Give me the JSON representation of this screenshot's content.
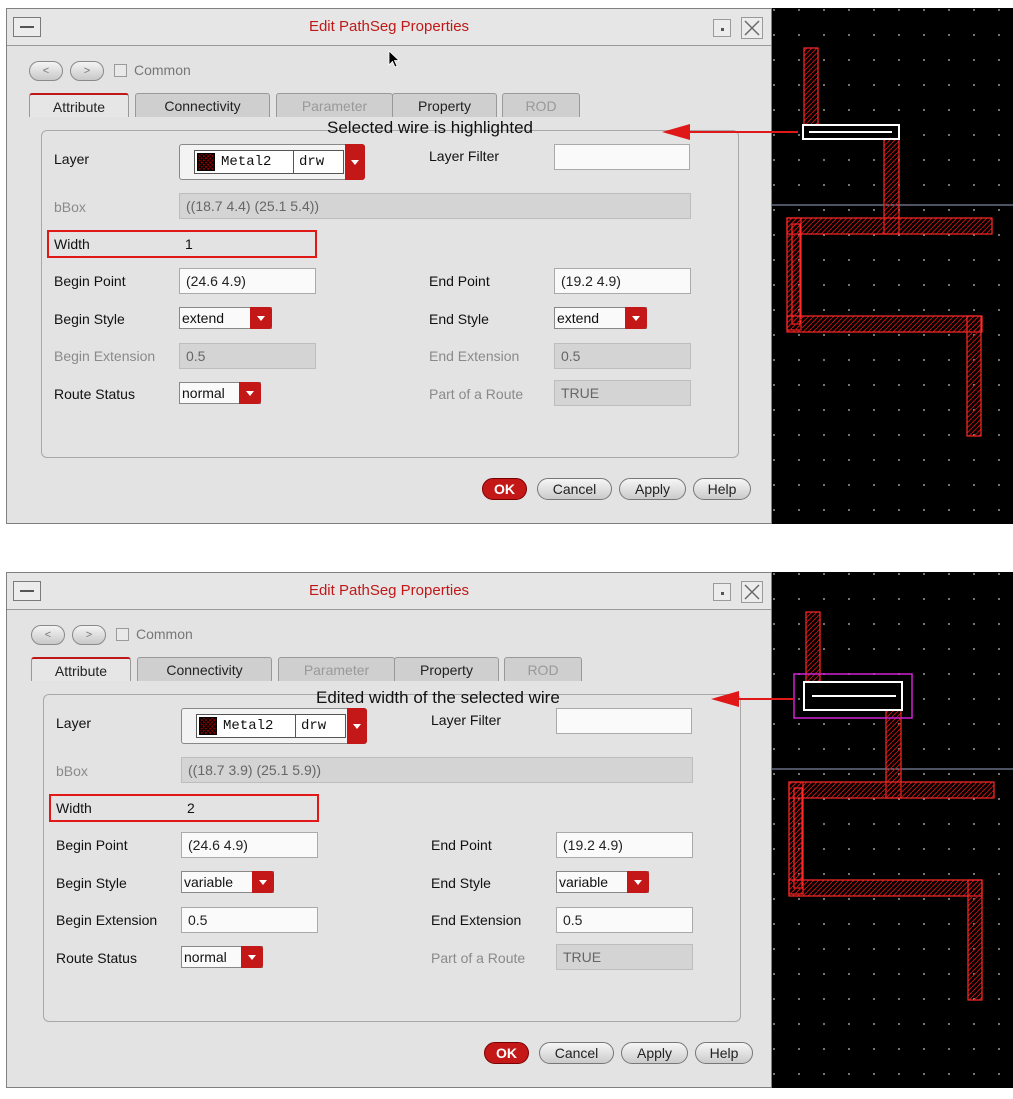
{
  "panels": [
    {
      "window_title": "Edit PathSeg Properties",
      "nav": {
        "back": "<",
        "forward": ">",
        "common": "Common"
      },
      "tabs": [
        {
          "label": "Attribute",
          "state": "active"
        },
        {
          "label": "Connectivity",
          "state": "enabled"
        },
        {
          "label": "Parameter",
          "state": "disabled"
        },
        {
          "label": "Property",
          "state": "enabled"
        },
        {
          "label": "ROD",
          "state": "disabled"
        }
      ],
      "layer": {
        "label": "Layer",
        "name": "Metal2",
        "purpose": "drw"
      },
      "layer_filter": {
        "label": "Layer Filter",
        "value": ""
      },
      "bbox": {
        "label": "bBox",
        "value": "((18.7 4.4) (25.1 5.4))"
      },
      "width": {
        "label": "Width",
        "value": "1"
      },
      "begin_point": {
        "label": "Begin Point",
        "value": "(24.6 4.9)"
      },
      "end_point": {
        "label": "End Point",
        "value": "(19.2 4.9)"
      },
      "begin_style": {
        "label": "Begin Style",
        "value": "extend"
      },
      "end_style": {
        "label": "End Style",
        "value": "extend"
      },
      "begin_extension": {
        "label": "Begin Extension",
        "value": "0.5",
        "editable": false
      },
      "end_extension": {
        "label": "End Extension",
        "value": "0.5",
        "editable": false
      },
      "route_status": {
        "label": "Route Status",
        "value": "normal"
      },
      "part_of_route": {
        "label": "Part of a Route",
        "value": "TRUE"
      },
      "buttons": {
        "ok": "OK",
        "cancel": "Cancel",
        "apply": "Apply",
        "help": "Help"
      },
      "annotation": "Selected wire is highlighted"
    },
    {
      "window_title": "Edit PathSeg Properties",
      "nav": {
        "back": "<",
        "forward": ">",
        "common": "Common"
      },
      "tabs": [
        {
          "label": "Attribute",
          "state": "active"
        },
        {
          "label": "Connectivity",
          "state": "enabled"
        },
        {
          "label": "Parameter",
          "state": "disabled"
        },
        {
          "label": "Property",
          "state": "enabled"
        },
        {
          "label": "ROD",
          "state": "disabled"
        }
      ],
      "layer": {
        "label": "Layer",
        "name": "Metal2",
        "purpose": "drw"
      },
      "layer_filter": {
        "label": "Layer Filter",
        "value": ""
      },
      "bbox": {
        "label": "bBox",
        "value": "((18.7 3.9) (25.1 5.9))"
      },
      "width": {
        "label": "Width",
        "value": "2"
      },
      "begin_point": {
        "label": "Begin Point",
        "value": "(24.6 4.9)"
      },
      "end_point": {
        "label": "End Point",
        "value": "(19.2 4.9)"
      },
      "begin_style": {
        "label": "Begin Style",
        "value": "variable"
      },
      "end_style": {
        "label": "End Style",
        "value": "variable"
      },
      "begin_extension": {
        "label": "Begin Extension",
        "value": "0.5",
        "editable": true
      },
      "end_extension": {
        "label": "End Extension",
        "value": "0.5",
        "editable": true
      },
      "route_status": {
        "label": "Route Status",
        "value": "normal"
      },
      "part_of_route": {
        "label": "Part of a Route",
        "value": "TRUE"
      },
      "buttons": {
        "ok": "OK",
        "cancel": "Cancel",
        "apply": "Apply",
        "help": "Help"
      },
      "annotation": "Edited width of the selected wire"
    }
  ],
  "colors": {
    "accent": "#c41818",
    "wire": "#e01818",
    "layout_bg": "#000000",
    "selection": "#ffffff",
    "edit_box": "#d020d0"
  }
}
